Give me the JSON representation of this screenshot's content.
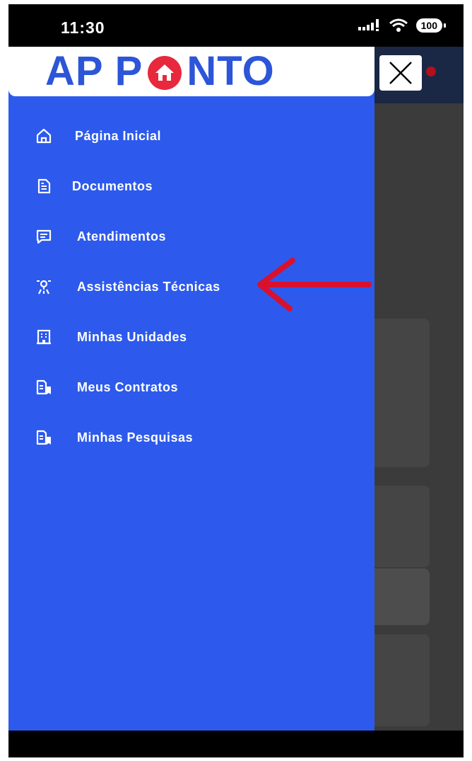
{
  "status_bar": {
    "time": "11:30",
    "battery": "100"
  },
  "drawer": {
    "logo_left": "AP P",
    "logo_right": "NTO",
    "items": [
      {
        "label": "Página Inicial",
        "icon": "home-icon"
      },
      {
        "label": "Documentos",
        "icon": "document-icon"
      },
      {
        "label": "Atendimentos",
        "icon": "chat-icon"
      },
      {
        "label": "Assistências Técnicas",
        "icon": "tools-icon"
      },
      {
        "label": "Minhas Unidades",
        "icon": "building-icon"
      },
      {
        "label": "Meus Contratos",
        "icon": "contract-icon"
      },
      {
        "label": "Minhas Pesquisas",
        "icon": "survey-icon"
      }
    ]
  },
  "colors": {
    "drawer_bg": "#2d5aec",
    "logo_blue": "#2c55d8",
    "logo_red": "#e8283c",
    "annotation_arrow": "#d8112e"
  }
}
